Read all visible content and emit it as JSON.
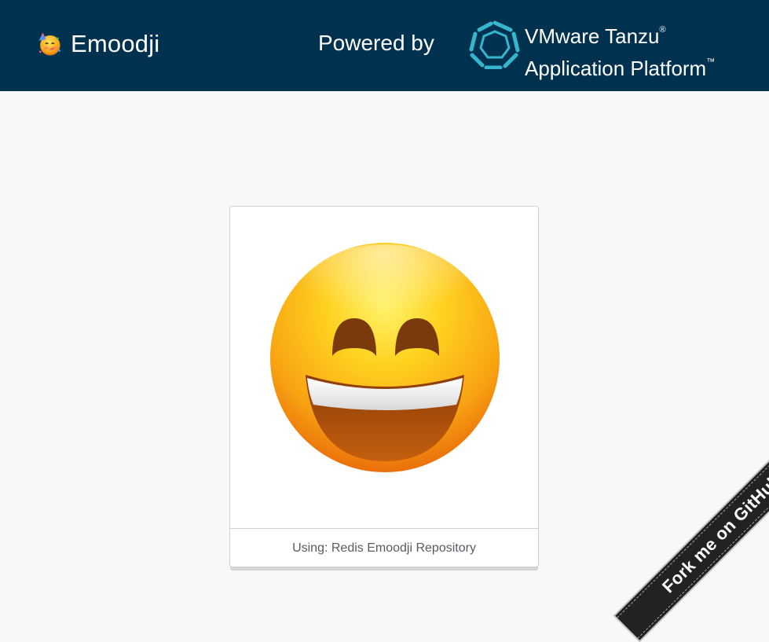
{
  "header": {
    "title": "Emoodji",
    "brand_icon": "partying-face-emoji-icon",
    "powered_by": "Powered by",
    "partner_logo": "tanzu-heptagon-icon",
    "partner_name_line1": "VMware Tanzu",
    "partner_name_line1_mark": "®",
    "partner_name_line2": "Application Platform",
    "partner_name_line2_mark": "™"
  },
  "card": {
    "emoji": "grinning-face-with-smiling-eyes-emoji",
    "footer_text": "Using: Redis Emoodji Repository"
  },
  "ribbon": {
    "label": "Fork me on GitHub"
  },
  "colors": {
    "header_bg": "#00324f",
    "page_bg": "#f8f8f8",
    "ribbon_bg": "#222222",
    "logo_teal": "#35b5ce"
  }
}
